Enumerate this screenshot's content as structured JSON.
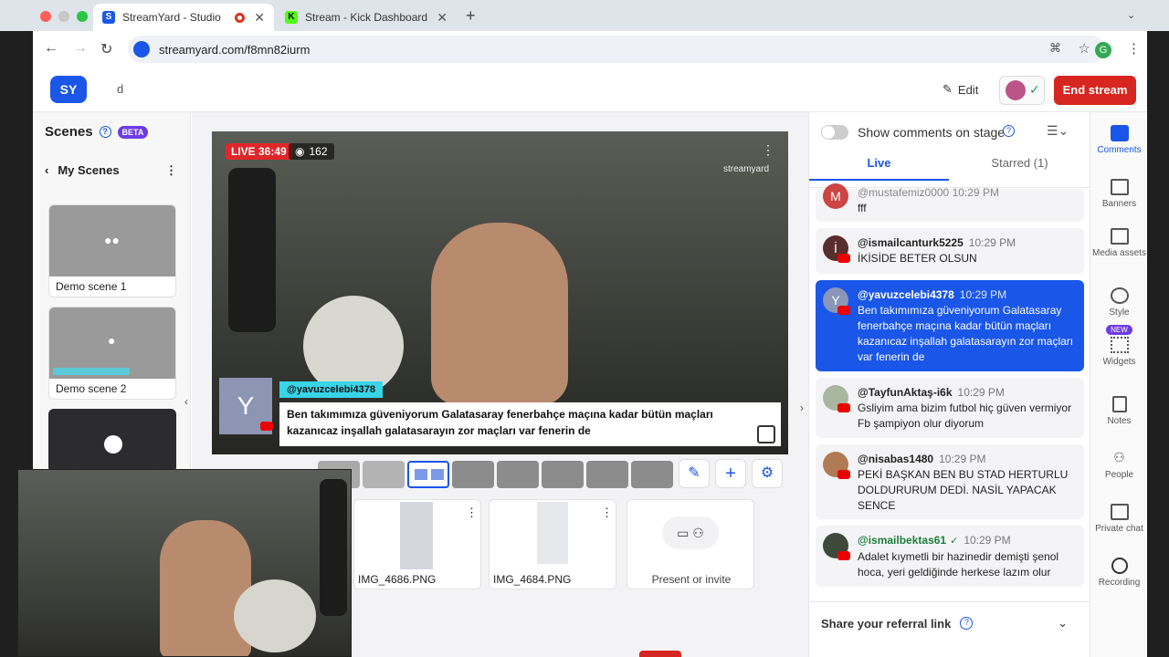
{
  "browser": {
    "tabs": [
      {
        "label": "StreamYard - Studio",
        "active": true
      },
      {
        "label": "Stream - Kick Dashboard",
        "active": false
      }
    ],
    "url": "streamyard.com/f8mn82iurm",
    "profile_initial": "G"
  },
  "topbar": {
    "title": "d",
    "edit_label": "Edit",
    "end_stream_label": "End stream"
  },
  "scenes": {
    "title": "Scenes",
    "beta": "BETA",
    "my_scenes": "My Scenes",
    "items": [
      {
        "label": "Demo scene 1"
      },
      {
        "label": "Demo scene 2"
      }
    ]
  },
  "stage": {
    "live_label": "LIVE 36:49",
    "viewers": "162",
    "watermark": "streamyard",
    "banner_user": "@yavuzcelebi4378",
    "banner_avatar": "Y",
    "banner_text": "Ben takımımıza güveniyorum Galatasaray fenerbahçe maçına kadar bütün maçları kazanıcaz inşallah galatasarayın zor maçları var fenerin de"
  },
  "media": [
    {
      "label": "IMG_4686.PNG"
    },
    {
      "label": "IMG_4684.PNG"
    },
    {
      "label": "Present or invite"
    }
  ],
  "comments_panel": {
    "toggle_label": "Show comments on stage",
    "tab_live": "Live",
    "tab_starred": "Starred (1)",
    "partial_user": "@mustafemiz0000",
    "partial_time": "10:29 PM",
    "partial_text": "fff",
    "comments": [
      {
        "user": "@ismailcanturk5225",
        "time": "10:29 PM",
        "text": "İKİSİDE BETER OLSUN",
        "avatar": "İ",
        "color": "#5a2d2d"
      },
      {
        "user": "@yavuzcelebi4378",
        "time": "10:29 PM",
        "text": "Ben takımımıza güveniyorum Galatasaray fenerbahçe maçına kadar bütün maçları kazanıcaz inşallah galatasarayın zor maçları var fenerin de",
        "avatar": "Y",
        "color": "#8a96b8"
      },
      {
        "user": "@TayfunAktaş-i6k",
        "time": "10:29 PM",
        "text": "Gsliyim ama bizim futbol hiç güven vermiyor Fb şampiyon olur diyorum",
        "avatar": "",
        "color": "#a9b7a0"
      },
      {
        "user": "@nisabas1480",
        "time": "10:29 PM",
        "text": "PEKİ BAŞKAN BEN BU STAD HERTURLU DOLDURURUM DEDİ. NASİL YAPACAK SENCE",
        "avatar": "",
        "color": "#b07a55"
      },
      {
        "user": "@ismailbektas61",
        "time": "10:29 PM",
        "text": "Adalet kıymetli bir hazinedir demişti şenol hoca, yeri geldiğinde herkese lazım olur",
        "avatar": "",
        "color": "#3d4a3a"
      }
    ],
    "referral": "Share your referral link"
  },
  "rail": [
    {
      "label": "Comments"
    },
    {
      "label": "Banners"
    },
    {
      "label": "Media assets"
    },
    {
      "label": "Style"
    },
    {
      "label": "Widgets",
      "badge": "NEW"
    },
    {
      "label": "Notes"
    },
    {
      "label": "People"
    },
    {
      "label": "Private chat"
    },
    {
      "label": "Recording"
    }
  ]
}
